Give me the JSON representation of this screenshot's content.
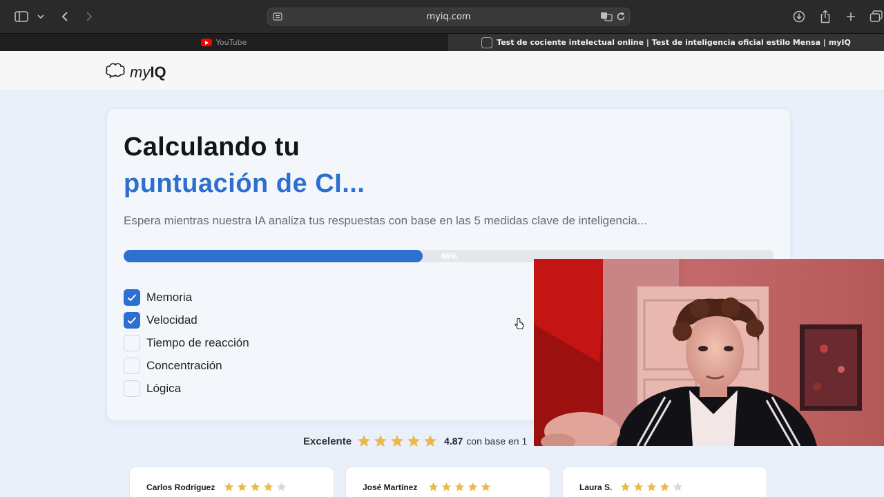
{
  "browser": {
    "url": "myiq.com",
    "tabs": [
      {
        "label": "YouTube"
      },
      {
        "label": "Test de cociente intelectual online | Test de inteligencia oficial estilo Mensa | myIQ"
      }
    ]
  },
  "site": {
    "logo_my": "my",
    "logo_iq": "IQ"
  },
  "card": {
    "title_line1": "Calculando tu",
    "title_line2": "puntuación de CI...",
    "subtitle": "Espera mientras nuestra IA analiza tus respuestas con base en las 5 medidas clave de inteligencia...",
    "progress_percent": 46,
    "progress_label": "46%",
    "checklist": [
      {
        "label": "Memoria",
        "checked": true
      },
      {
        "label": "Velocidad",
        "checked": true
      },
      {
        "label": "Tiempo de reacción",
        "checked": false
      },
      {
        "label": "Concentración",
        "checked": false
      },
      {
        "label": "Lógica",
        "checked": false
      }
    ]
  },
  "rating": {
    "label": "Excelente",
    "score": "4.87",
    "basis_text": "con base en 1"
  },
  "reviews": [
    {
      "name": "Carlos Rodríguez",
      "stars": 4
    },
    {
      "name": "José Martínez",
      "stars": 5
    },
    {
      "name": "Laura S.",
      "stars": 4
    }
  ],
  "colors": {
    "accent": "#2e6fd2",
    "star": "#e9b949",
    "star_empty": "#d8d8d8"
  },
  "icons": [
    "sidebar-icon",
    "chevron-down-icon",
    "back-icon",
    "forward-icon",
    "reader-icon",
    "translate-icon",
    "reload-icon",
    "download-icon",
    "share-icon",
    "new-tab-icon",
    "tab-overview-icon",
    "brain-logo-icon",
    "checkmark-icon",
    "star-icon",
    "pointer-cursor-icon"
  ]
}
